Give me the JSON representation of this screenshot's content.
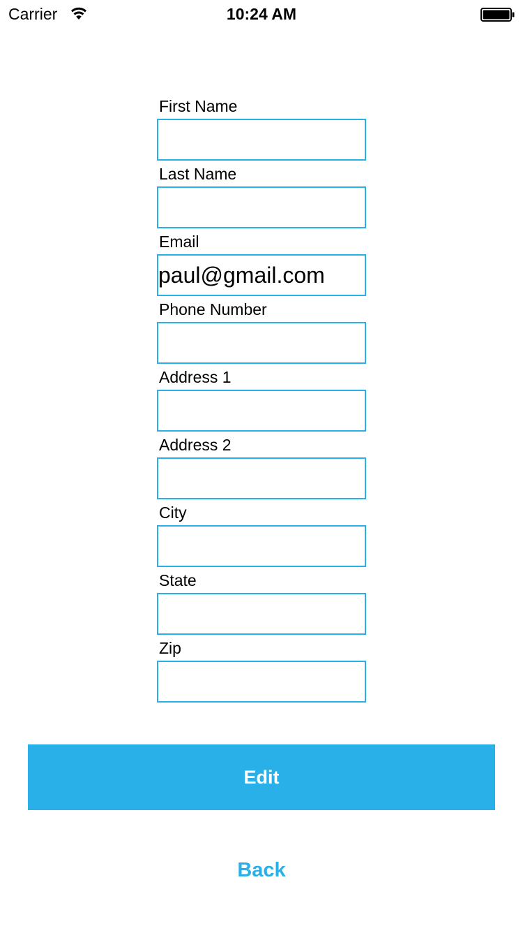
{
  "status_bar": {
    "carrier": "Carrier",
    "time": "10:24 AM",
    "wifi_icon": "wifi-icon",
    "battery_icon": "battery-full-icon"
  },
  "form": {
    "fields": [
      {
        "label": "First Name",
        "value": ""
      },
      {
        "label": "Last Name",
        "value": ""
      },
      {
        "label": "Email",
        "value": "paul@gmail.com"
      },
      {
        "label": "Phone Number",
        "value": ""
      },
      {
        "label": "Address 1",
        "value": ""
      },
      {
        "label": "Address 2",
        "value": ""
      },
      {
        "label": "City",
        "value": ""
      },
      {
        "label": "State",
        "value": ""
      },
      {
        "label": "Zip",
        "value": ""
      }
    ]
  },
  "actions": {
    "edit_label": "Edit",
    "back_label": "Back"
  },
  "colors": {
    "accent": "#29b0e8",
    "background": "#ffffff",
    "text": "#000000"
  }
}
